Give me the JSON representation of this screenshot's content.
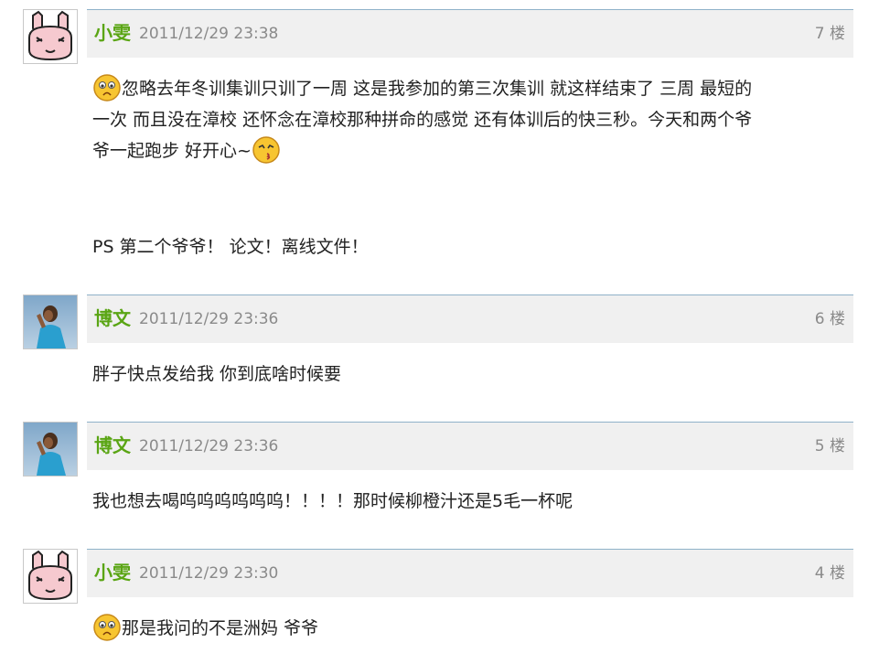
{
  "comments": [
    {
      "author": "小雯",
      "time": "2011/12/29 23:38",
      "floor": "7 楼",
      "avatar": "rabbit-avatar",
      "text_line1": "忽略去年冬训集训只训了一周 这是我参加的第三次集训 就这样结束了 三周 最短的",
      "text_line2": "一次 而且没在漳校 还怀念在漳校那种拼命的感觉 还有体训后的快三秒。今天和两个爷",
      "text_line3": "爷一起跑步 好开心~",
      "ps": "PS  第二个爷爷！ 论文！离线文件！"
    },
    {
      "author": "博文",
      "time": "2011/12/29 23:36",
      "floor": "6 楼",
      "avatar": "photo-avatar",
      "text": "胖子快点发给我 你到底啥时候要"
    },
    {
      "author": "博文",
      "time": "2011/12/29 23:36",
      "floor": "5 楼",
      "avatar": "photo-avatar",
      "text": "我也想去喝呜呜呜呜呜呜！！！！那时候柳橙汁还是5毛一杯呢"
    },
    {
      "author": "小雯",
      "time": "2011/12/29 23:30",
      "floor": "4 楼",
      "avatar": "rabbit-avatar",
      "text": "那是我问的不是洲妈 爷爷"
    }
  ],
  "colors": {
    "author": "#5aa514",
    "meta": "#8a8a8a",
    "header_bg": "#f0f0f0",
    "header_border": "#8fb2c9"
  }
}
